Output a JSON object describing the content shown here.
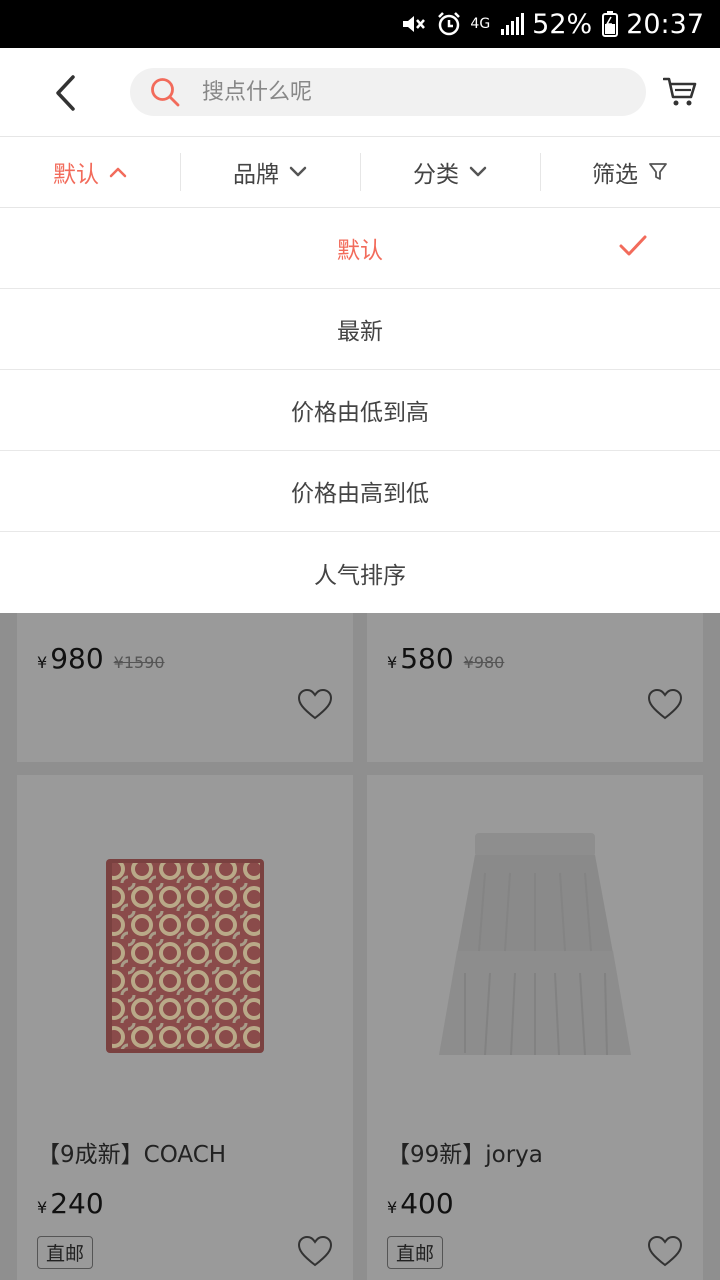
{
  "status_bar": {
    "battery": "52%",
    "time": "20:37",
    "network": "4G",
    "icons": [
      "mute-icon",
      "alarm-icon",
      "signal-icon",
      "battery-icon"
    ]
  },
  "header": {
    "search_placeholder": "搜点什么呢",
    "icons": [
      "back-arrow-icon",
      "search-icon",
      "cart-icon"
    ]
  },
  "sort_tabs": [
    {
      "label": "默认",
      "active": true
    },
    {
      "label": "品牌",
      "active": false
    },
    {
      "label": "分类",
      "active": false
    },
    {
      "label": "筛选",
      "active": false
    }
  ],
  "dropdown": {
    "items": [
      {
        "label": "默认",
        "selected": true
      },
      {
        "label": "最新",
        "selected": false
      },
      {
        "label": "价格由低到高",
        "selected": false
      },
      {
        "label": "价格由高到低",
        "selected": false
      },
      {
        "label": "人气排序",
        "selected": false
      }
    ]
  },
  "products": [
    {
      "currency": "¥",
      "price": "980",
      "original_price": "¥1590"
    },
    {
      "currency": "¥",
      "price": "580",
      "original_price": "¥980"
    },
    {
      "title": "【9成新】COACH",
      "currency": "¥",
      "price": "240",
      "tag": "直邮"
    },
    {
      "title": "【99新】jorya",
      "currency": "¥",
      "price": "400",
      "tag": "直邮"
    }
  ],
  "colors": {
    "accent": "#f26b5b",
    "overlay": "#8c8c8c"
  }
}
